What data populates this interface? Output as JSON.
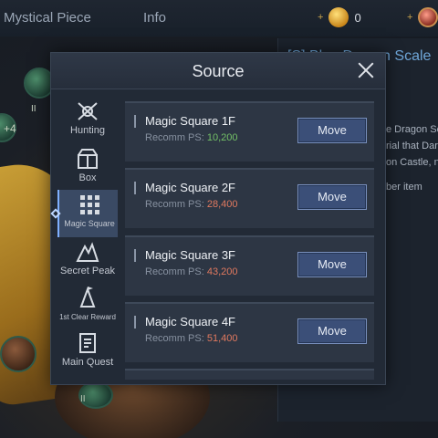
{
  "topbar": {
    "tab_mystical": "Mystical Piece",
    "tab_info": "Info",
    "currency1_plus": "+",
    "currency1_value": "0",
    "currency2_plus": "+"
  },
  "background_panel": {
    "title": "[S] Blue Dragon Scale",
    "lines": [
      "e Dragon Sc",
      "rial that Dar",
      "on Castle, n",
      "ber item"
    ]
  },
  "scene": {
    "plus_text": "+4",
    "roman_marks": [
      "II",
      "II"
    ]
  },
  "dialog": {
    "title": "Source",
    "sidebar": [
      {
        "label": "Hunting",
        "icon": "hunting-icon"
      },
      {
        "label": "Box",
        "icon": "box-icon"
      },
      {
        "label": "Magic Square",
        "icon": "magic-square-icon",
        "active": true
      },
      {
        "label": "Secret Peak",
        "icon": "secret-peak-icon"
      },
      {
        "label": "1st Clear Reward",
        "icon": "clear-reward-icon"
      },
      {
        "label": "Main Quest",
        "icon": "main-quest-icon"
      }
    ],
    "entries": [
      {
        "name": "Magic Square 1F",
        "ps_label": "Recomm PS:",
        "ps_value": "10,200",
        "ps_color": "#74c267",
        "button": "Move"
      },
      {
        "name": "Magic Square 2F",
        "ps_label": "Recomm PS:",
        "ps_value": "28,400",
        "ps_color": "#e0795f",
        "button": "Move"
      },
      {
        "name": "Magic Square 3F",
        "ps_label": "Recomm PS:",
        "ps_value": "43,200",
        "ps_color": "#e0795f",
        "button": "Move"
      },
      {
        "name": "Magic Square 4F",
        "ps_label": "Recomm PS:",
        "ps_value": "51,400",
        "ps_color": "#e0795f",
        "button": "Move"
      }
    ]
  },
  "colors": {
    "accent": "#7fb0ff",
    "button": "#3b4f78",
    "ps_ok": "#74c267",
    "ps_high": "#e0795f"
  }
}
